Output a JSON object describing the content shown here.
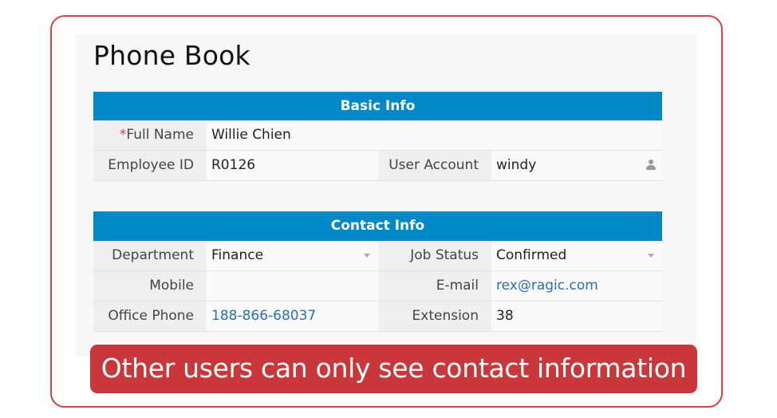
{
  "page": {
    "title": "Phone Book"
  },
  "sections": {
    "basic": {
      "header": "Basic Info",
      "full_name_required_mark": "*",
      "full_name_label": "Full Name",
      "full_name_value": "Willie Chien",
      "employee_id_label": "Employee ID",
      "employee_id_value": "R0126",
      "user_account_label": "User Account",
      "user_account_value": "windy"
    },
    "contact": {
      "header": "Contact Info",
      "department_label": "Department",
      "department_value": "Finance",
      "job_status_label": "Job Status",
      "job_status_value": "Confirmed",
      "mobile_label": "Mobile",
      "mobile_value": "",
      "email_label": "E-mail",
      "email_value": "rex@ragic.com",
      "office_phone_label": "Office Phone",
      "office_phone_value": "188-866-68037",
      "extension_label": "Extension",
      "extension_value": "38"
    }
  },
  "banner": {
    "text": "Other users can only see contact information"
  },
  "colors": {
    "section_header": "#0189c7",
    "banner": "#c9373a",
    "frame_border": "#cf4447",
    "link": "#2a6fb0",
    "required": "#e0393b"
  }
}
